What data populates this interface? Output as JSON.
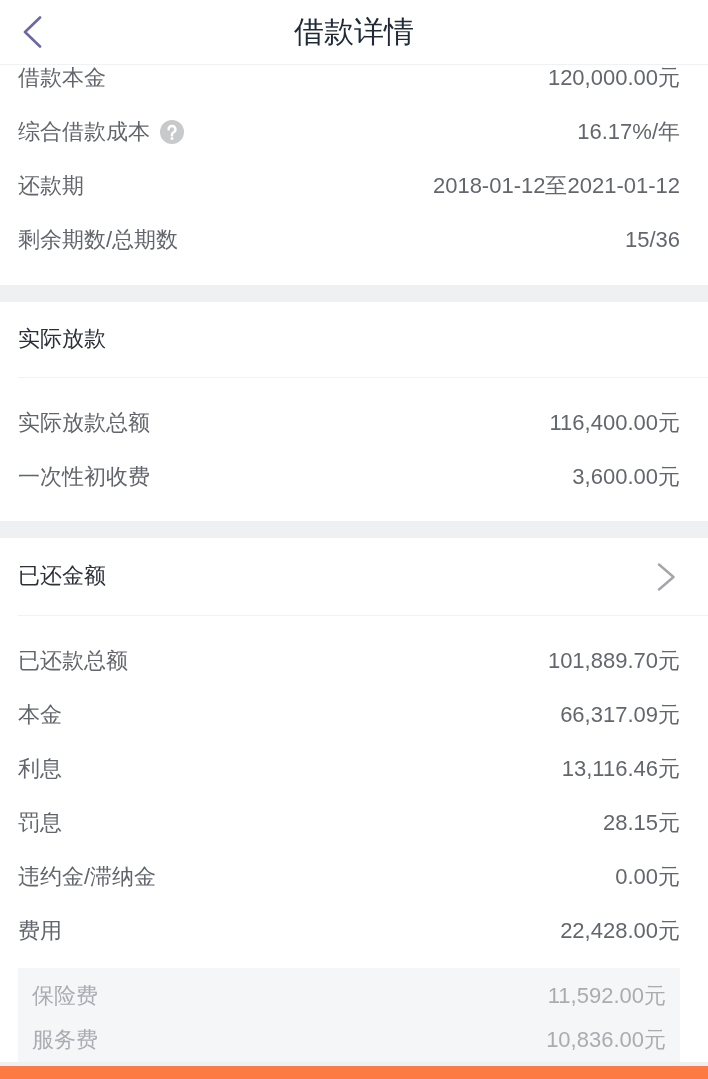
{
  "header": {
    "title": "借款详情"
  },
  "sections": [
    {
      "kind": "plain",
      "rows": [
        {
          "label": "借款本金",
          "value": "120,000.00元",
          "kind": "plain"
        },
        {
          "label": "综合借款成本",
          "value": "16.17%/年",
          "kind": "help"
        },
        {
          "label": "还款期",
          "value": "2018-01-12至2021-01-12",
          "kind": "plain"
        },
        {
          "label": "剩余期数/总期数",
          "value": "15/36",
          "kind": "plain"
        }
      ]
    },
    {
      "kind": "titled",
      "title": "实际放款",
      "rows": [
        {
          "label": "实际放款总额",
          "value": "116,400.00元"
        },
        {
          "label": "一次性初收费",
          "value": "3,600.00元"
        }
      ]
    },
    {
      "kind": "link",
      "title": "已还金额",
      "rows": [
        {
          "label": "已还款总额",
          "value": "101,889.70元"
        },
        {
          "label": "本金",
          "value": "66,317.09元"
        },
        {
          "label": "利息",
          "value": "13,116.46元"
        },
        {
          "label": "罚息",
          "value": "28.15元"
        },
        {
          "label": "违约金/滞纳金",
          "value": "0.00元"
        },
        {
          "label": "费用",
          "value": "22,428.00元"
        }
      ],
      "details": [
        {
          "label": "保险费",
          "value": "11,592.00元"
        },
        {
          "label": "服务费",
          "value": "10,836.00元"
        }
      ]
    }
  ]
}
